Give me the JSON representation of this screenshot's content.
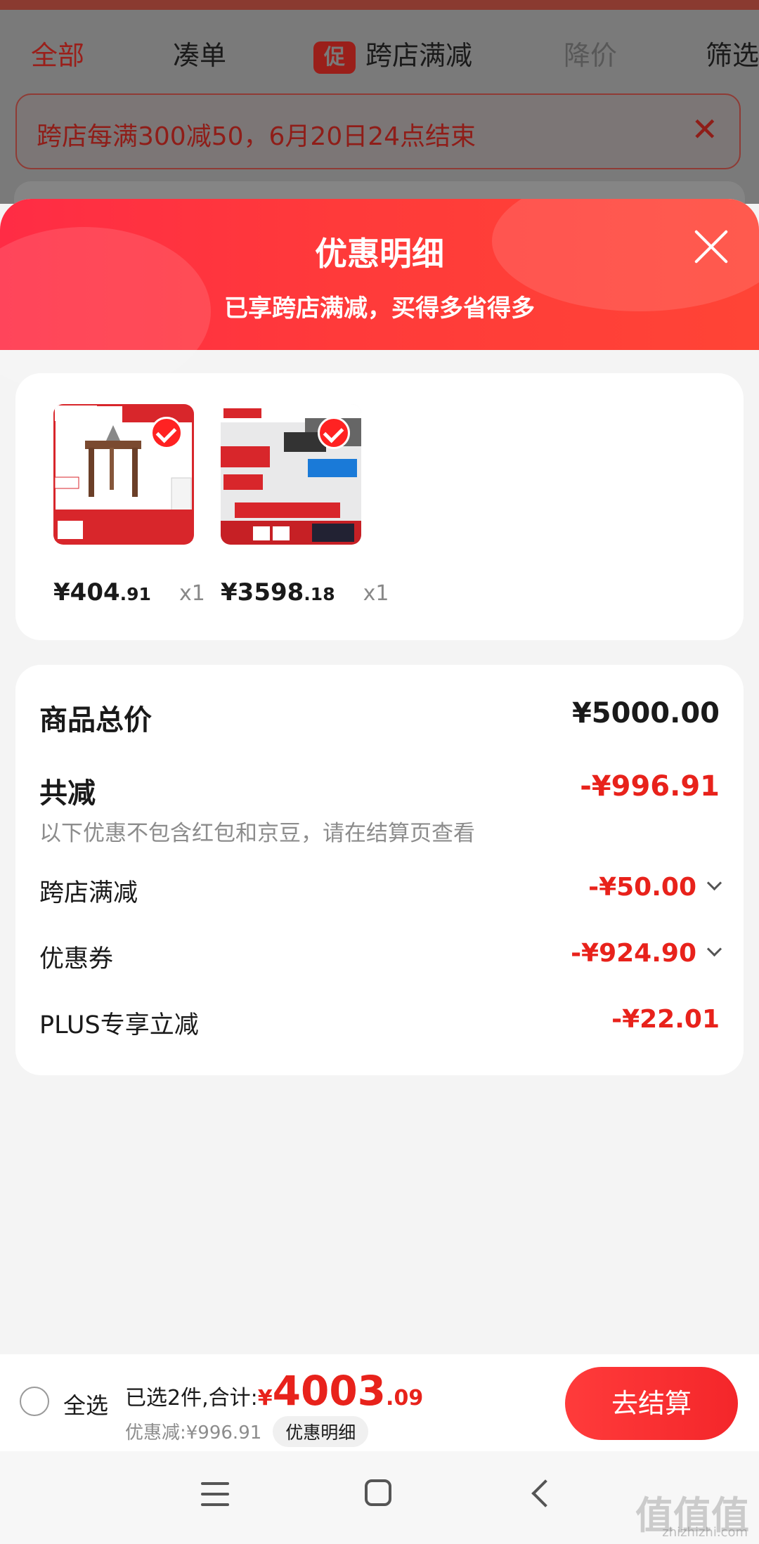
{
  "tabs": [
    {
      "label": "全部",
      "active": true
    },
    {
      "label": "凑单"
    },
    {
      "label": "跨店满减",
      "badge": "促"
    },
    {
      "label": "降价"
    },
    {
      "label": "筛选"
    }
  ],
  "banner": {
    "text": "跨店每满300减50，6月20日24点结束"
  },
  "sheet": {
    "title": "优惠明细",
    "subtitle": "已享跨店满减，买得多省得多"
  },
  "products": [
    {
      "name": "chair-product",
      "price_int": "¥404",
      "price_dec": ".91",
      "qty": "x1"
    },
    {
      "name": "range-hood-product",
      "price_int": "¥3598",
      "price_dec": ".18",
      "qty": "x1"
    }
  ],
  "summary": {
    "total_label": "商品总价",
    "total_value": "¥5000.00",
    "discount_label": "共减",
    "discount_value": "-¥996.91",
    "note": "以下优惠不包含红包和京豆，请在结算页查看",
    "items": [
      {
        "label": "跨店满减",
        "value": "-¥50.00",
        "expandable": true
      },
      {
        "label": "优惠券",
        "value": "-¥924.90",
        "expandable": true
      },
      {
        "label": "PLUS专享立减",
        "value": "-¥22.01",
        "expandable": false
      }
    ]
  },
  "bottom_bar": {
    "select_all": "全选",
    "selected_text": "已选2件,合计:",
    "total_symbol": "¥",
    "total_int": "4003",
    "total_dec": ".09",
    "discount_text": "优惠减:¥996.91",
    "detail_button": "优惠明细",
    "checkout_button": "去结算"
  },
  "watermark": {
    "logo": "值值值",
    "url": "zhizhizhi.com"
  },
  "colors": {
    "accent": "#e8221b",
    "header_red": "#ff2c45"
  }
}
